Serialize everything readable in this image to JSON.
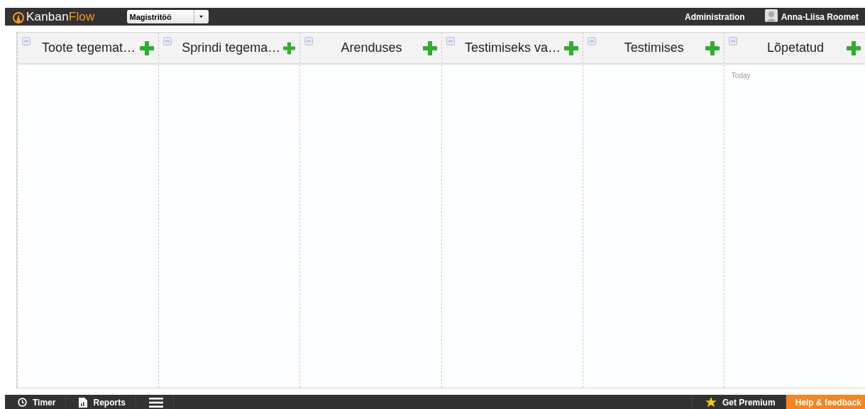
{
  "top_bar": {
    "logo": {
      "primary": "Kanban",
      "accent": "Flow"
    },
    "board_select": {
      "value": "Magistritöö"
    },
    "links": [
      "Administration"
    ],
    "user": {
      "name": "Anna-Liisa Roomet"
    }
  },
  "columns": [
    {
      "title": "Toote tegemat…"
    },
    {
      "title": "Sprindi tegema…"
    },
    {
      "title": "Arenduses"
    },
    {
      "title": "Testimiseks va…"
    },
    {
      "title": "Testimises"
    },
    {
      "title": "Lõpetatud",
      "items": [
        "Today"
      ]
    }
  ],
  "bottom_bar": {
    "left": [
      {
        "kind": "timer",
        "label": "Timer"
      },
      {
        "kind": "reports",
        "label": "Reports"
      },
      {
        "kind": "menu"
      }
    ],
    "right": [
      {
        "kind": "premium",
        "label": "Get Premium"
      },
      {
        "kind": "help",
        "label": "Help & feedback"
      }
    ]
  }
}
